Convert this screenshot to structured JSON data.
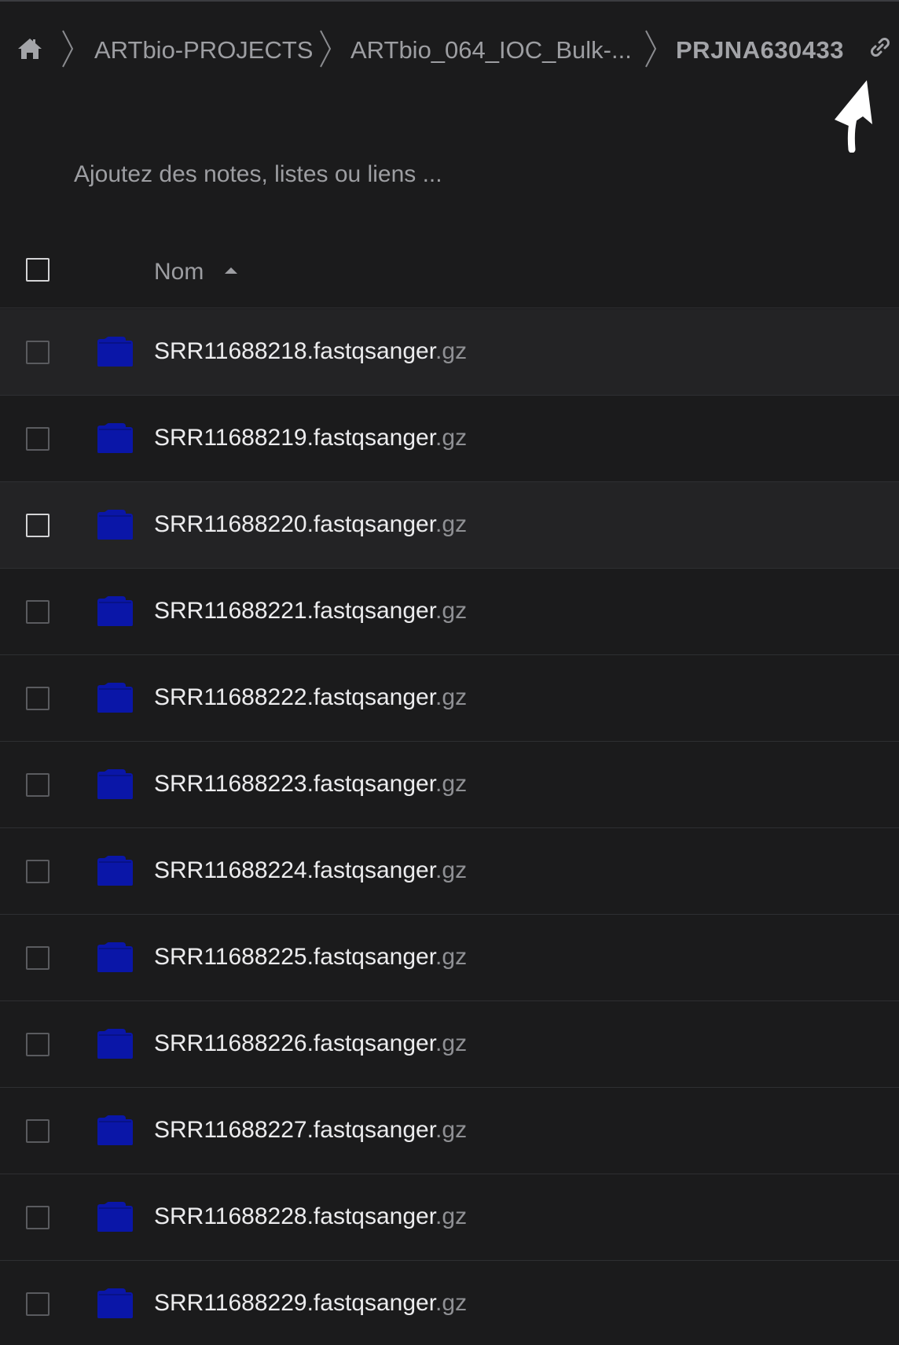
{
  "breadcrumb": {
    "home_icon": "home-icon",
    "items": [
      {
        "label": "ARTbio-PROJECTS"
      },
      {
        "label": "ARTbio_064_IOC_Bulk-..."
      },
      {
        "label": "PRJNA630433"
      }
    ],
    "link_icon": "link-icon"
  },
  "notes": {
    "placeholder": "Ajoutez des notes, listes ou liens ..."
  },
  "list": {
    "header": {
      "name_label": "Nom",
      "sort": "ascending"
    },
    "files": [
      {
        "basename": "SRR11688218.fastqsanger",
        "ext": ".gz"
      },
      {
        "basename": "SRR11688219.fastqsanger",
        "ext": ".gz"
      },
      {
        "basename": "SRR11688220.fastqsanger",
        "ext": ".gz"
      },
      {
        "basename": "SRR11688221.fastqsanger",
        "ext": ".gz"
      },
      {
        "basename": "SRR11688222.fastqsanger",
        "ext": ".gz"
      },
      {
        "basename": "SRR11688223.fastqsanger",
        "ext": ".gz"
      },
      {
        "basename": "SRR11688224.fastqsanger",
        "ext": ".gz"
      },
      {
        "basename": "SRR11688225.fastqsanger",
        "ext": ".gz"
      },
      {
        "basename": "SRR11688226.fastqsanger",
        "ext": ".gz"
      },
      {
        "basename": "SRR11688227.fastqsanger",
        "ext": ".gz"
      },
      {
        "basename": "SRR11688228.fastqsanger",
        "ext": ".gz"
      },
      {
        "basename": "SRR11688229.fastqsanger",
        "ext": ".gz"
      }
    ]
  },
  "colors": {
    "background": "#1b1b1c",
    "row_hover": "#232325",
    "folder_blue": "#0a16a8",
    "text_primary": "#ececee",
    "text_muted": "#9d9ea2"
  }
}
